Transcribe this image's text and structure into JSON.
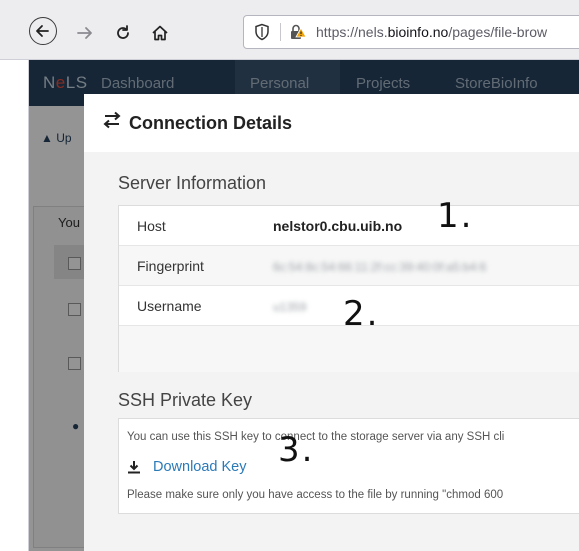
{
  "browser": {
    "url_prefix": "https://nels.",
    "url_domain": "bioinfo.no",
    "url_suffix": "/pages/file-brow"
  },
  "app": {
    "brand_a": "N",
    "brand_b": "e",
    "brand_c": "LS",
    "nav": [
      "Dashboard",
      "Personal",
      "Projects",
      "StoreBioInfo"
    ],
    "active_nav": "Personal",
    "upload_label": "Up",
    "behind_label": "You"
  },
  "modal": {
    "title": "Connection Details",
    "server_section_title": "Server Information",
    "server_rows": [
      {
        "label": "Host",
        "value": "nelstor0.cbu.uib.no"
      },
      {
        "label": "Fingerprint",
        "value": "6c:54:8c:54:66:11:2f:cc:39:40:0f:a5:b4:6"
      },
      {
        "label": "Username",
        "value": "u1359"
      }
    ],
    "key_section_title": "SSH Private Key",
    "key_description": "You can use this SSH key to connect to the storage server via any SSH cli",
    "download_label": "Download Key",
    "key_note": "Please make sure only you have access to the file by running \"chmod 600"
  },
  "annotations": [
    "1.",
    "2.",
    "3."
  ],
  "colors": {
    "header_bg": "#26435f",
    "link": "#2a7ab8",
    "brand_red": "#e74c3c"
  }
}
